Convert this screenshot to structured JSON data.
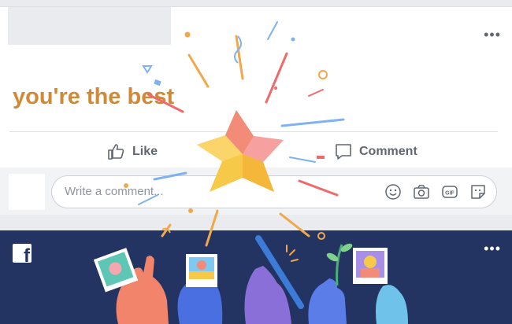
{
  "post": {
    "text": "you're the best",
    "more_label": "•••",
    "actions": {
      "like_label": "Like",
      "comment_label": "Comment"
    },
    "composer": {
      "placeholder": "Write a comment..."
    }
  },
  "banner": {
    "brand_letter": "f",
    "more_label": "•••"
  },
  "colors": {
    "post_text": "#d08a37",
    "banner_bg": "#233462",
    "star_yellow": "#f7c948",
    "star_pink": "#f28b77"
  },
  "icons": [
    "thumbs-up-icon",
    "comment-bubble-icon",
    "emoji-icon",
    "camera-icon",
    "gif-icon",
    "sticker-icon",
    "facebook-logo-icon",
    "star-icon"
  ]
}
